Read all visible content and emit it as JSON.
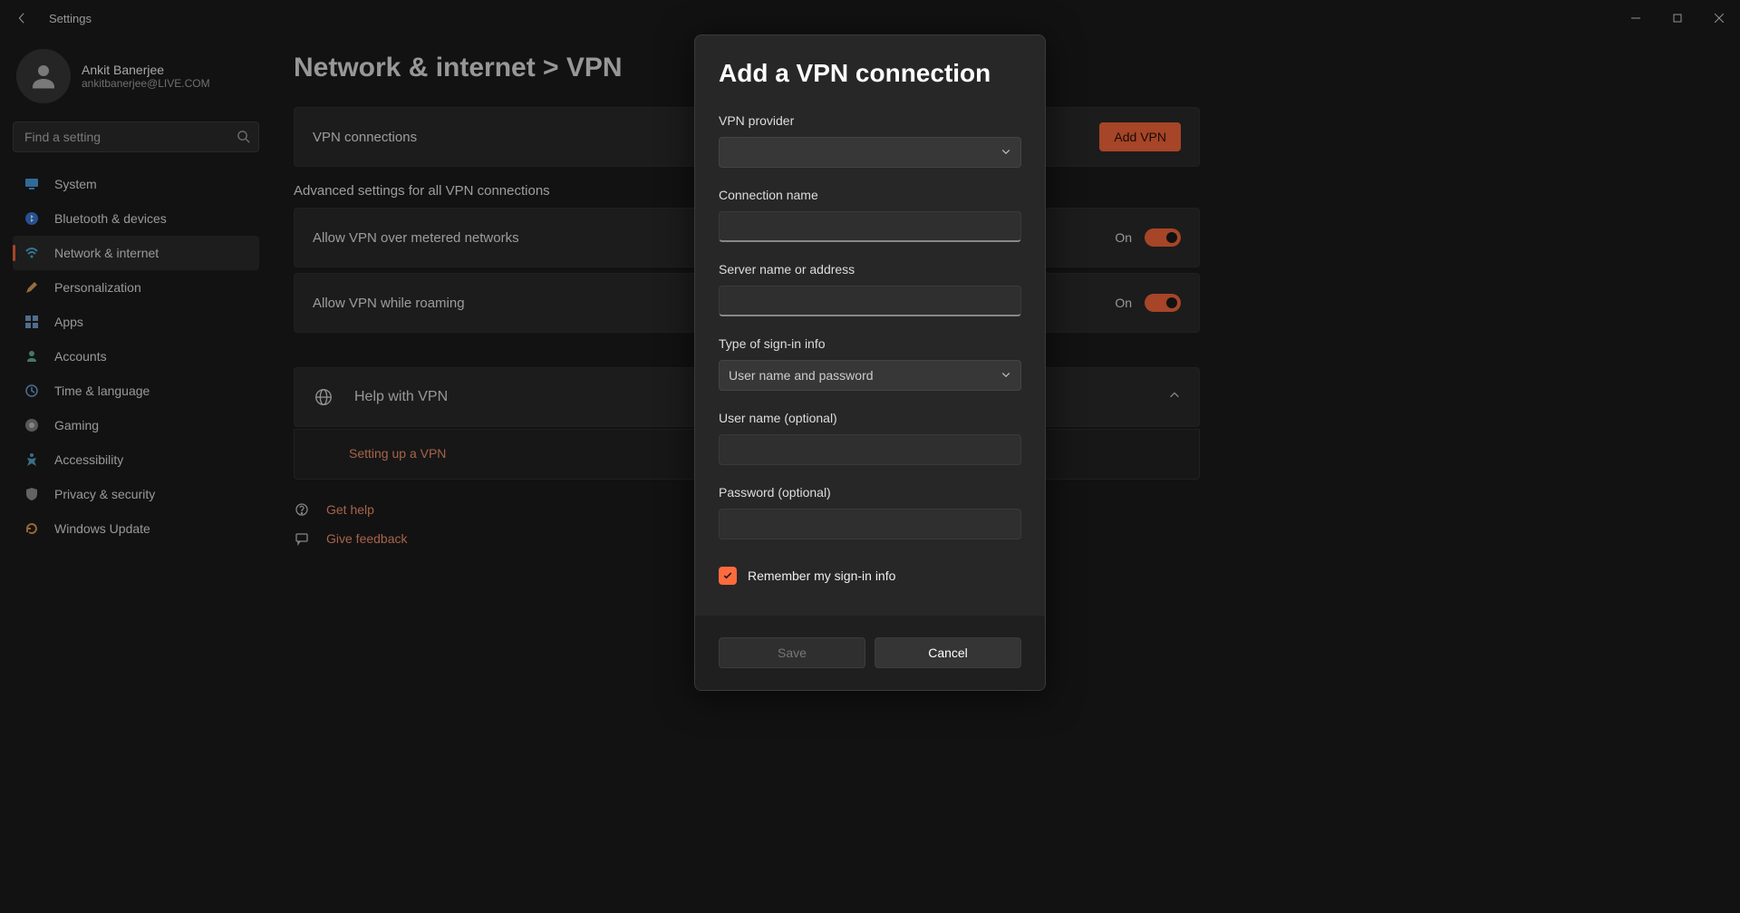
{
  "titlebar": {
    "title": "Settings"
  },
  "user": {
    "name": "Ankit Banerjee",
    "email": "ankitbanerjee@LIVE.COM"
  },
  "search": {
    "placeholder": "Find a setting"
  },
  "nav": {
    "items": [
      {
        "id": "system",
        "label": "System"
      },
      {
        "id": "bluetooth",
        "label": "Bluetooth & devices"
      },
      {
        "id": "network",
        "label": "Network & internet"
      },
      {
        "id": "personalization",
        "label": "Personalization"
      },
      {
        "id": "apps",
        "label": "Apps"
      },
      {
        "id": "accounts",
        "label": "Accounts"
      },
      {
        "id": "time",
        "label": "Time & language"
      },
      {
        "id": "gaming",
        "label": "Gaming"
      },
      {
        "id": "accessibility",
        "label": "Accessibility"
      },
      {
        "id": "privacy",
        "label": "Privacy & security"
      },
      {
        "id": "update",
        "label": "Windows Update"
      }
    ]
  },
  "page": {
    "breadcrumb": "Network & internet > VPN",
    "vpn_connections_label": "VPN connections",
    "add_vpn_btn": "Add VPN",
    "advanced_heading": "Advanced settings for all VPN connections",
    "metered_label": "Allow VPN over metered networks",
    "metered_state": "On",
    "roaming_label": "Allow VPN while roaming",
    "roaming_state": "On",
    "help_with_vpn": "Help with VPN",
    "setup_link": "Setting up a VPN",
    "get_help": "Get help",
    "give_feedback": "Give feedback"
  },
  "modal": {
    "title": "Add a VPN connection",
    "vpn_provider_label": "VPN provider",
    "vpn_provider_value": "",
    "connection_name_label": "Connection name",
    "connection_name_value": "",
    "server_label": "Server name or address",
    "server_value": "",
    "signin_type_label": "Type of sign-in info",
    "signin_type_value": "User name and password",
    "username_label": "User name (optional)",
    "username_value": "",
    "password_label": "Password (optional)",
    "password_value": "",
    "remember_label": "Remember my sign-in info",
    "save_btn": "Save",
    "cancel_btn": "Cancel"
  },
  "colors": {
    "accent": "#ff6b3d"
  }
}
